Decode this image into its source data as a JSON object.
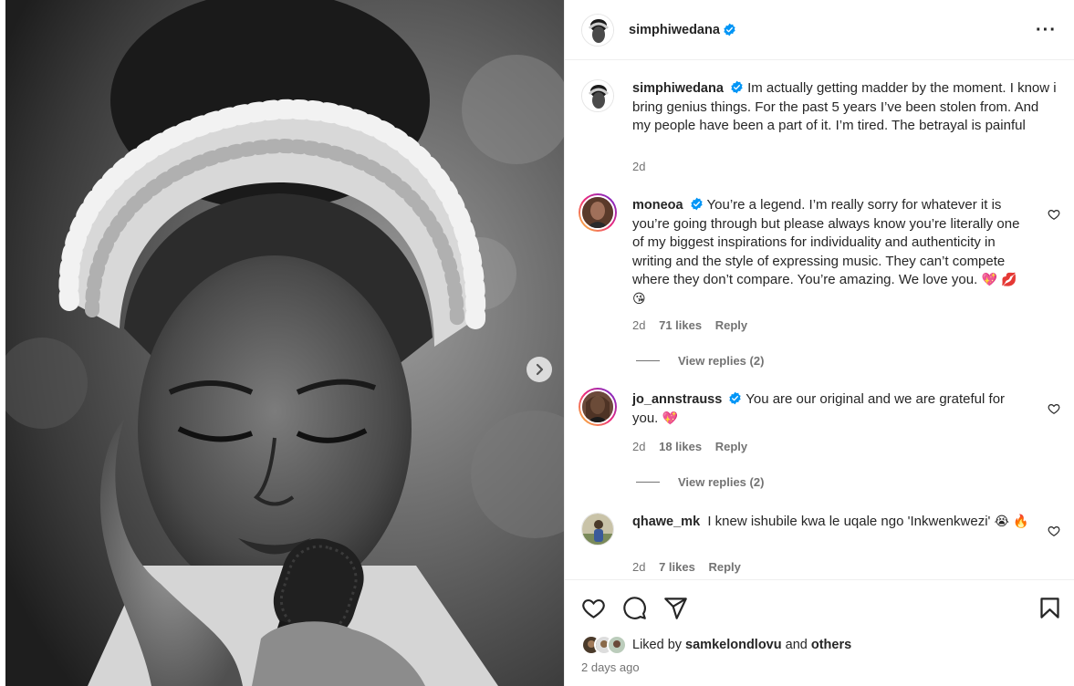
{
  "post": {
    "author": "simphiwedana",
    "verified": true
  },
  "caption": {
    "username": "simphiwedana",
    "text": "Im actually getting madder by the moment. I know i bring genius things. For the past 5 years I’ve been stolen from. And my people have been a part of it. I’m tired. The betrayal is painful",
    "time": "2d"
  },
  "comments": [
    {
      "username": "moneoa",
      "verified": true,
      "text": "You’re a legend. I’m really sorry for whatever it is you’re going through but please always know you’re literally one of my biggest inspirations for individuality and authenticity in writing and the style of expressing music. They can’t compete where they don’t compare. You’re amazing. We love you.",
      "emojis": "💖 💋 😘",
      "time": "2d",
      "likes": "71 likes",
      "reply": "Reply",
      "view_replies": "View replies (2)"
    },
    {
      "username": "jo_annstrauss",
      "verified": true,
      "text": "You are our original and we are grateful for you.",
      "emojis": "💖",
      "time": "2d",
      "likes": "18 likes",
      "reply": "Reply",
      "view_replies": "View replies (2)"
    },
    {
      "username": "qhawe_mk",
      "verified": false,
      "text": "I knew ishubile kwa le uqale ngo 'Inkwenkwezi'",
      "emojis": "😭 🔥",
      "time": "2d",
      "likes": "7 likes",
      "reply": "Reply"
    }
  ],
  "footer": {
    "liked_by_prefix": "Liked by",
    "liked_by_user": "samkelondlovu",
    "and": "and",
    "others": "others",
    "posted": "2 days ago"
  },
  "icons": {
    "more": "more-options-icon",
    "verified": "verified-badge-icon",
    "like": "heart-icon",
    "comment": "comment-icon",
    "share": "share-icon",
    "save": "bookmark-icon",
    "next": "chevron-right-icon"
  },
  "colors": {
    "verified": "#0095f6",
    "text": "#262626",
    "muted": "#737373"
  }
}
